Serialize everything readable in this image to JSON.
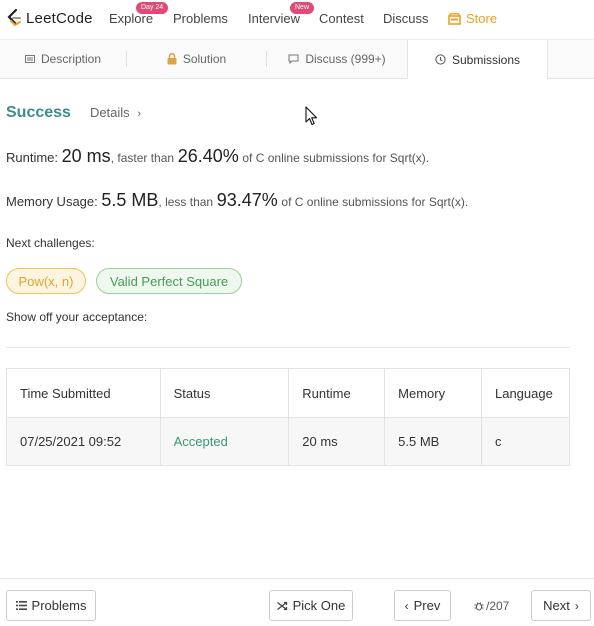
{
  "nav": {
    "brand": "LeetCode",
    "items": [
      {
        "label": "Explore",
        "badge": "Day 24"
      },
      {
        "label": "Problems"
      },
      {
        "label": "Interview",
        "badge": "New"
      },
      {
        "label": "Contest"
      },
      {
        "label": "Discuss"
      },
      {
        "label": "Store"
      }
    ]
  },
  "tabs": [
    {
      "label": "Description",
      "icon": "document-icon"
    },
    {
      "label": "Solution",
      "icon": "lock-icon"
    },
    {
      "label": "Discuss (999+)",
      "icon": "comment-icon"
    },
    {
      "label": "Submissions",
      "icon": "clock-icon",
      "active": true
    }
  ],
  "result": {
    "status": "Success",
    "details_label": "Details",
    "runtime_prefix": "Runtime:",
    "runtime_value": "20 ms",
    "runtime_mid": ", faster than",
    "runtime_pct": "26.40%",
    "runtime_suffix": "of C online submissions for Sqrt(x).",
    "memory_prefix": "Memory Usage:",
    "memory_value": "5.5 MB",
    "memory_mid": ", less than",
    "memory_pct": "93.47%",
    "memory_suffix": "of C online submissions for Sqrt(x).",
    "next_challenges_label": "Next challenges:",
    "challenges": [
      "Pow(x, n)",
      "Valid Perfect Square"
    ],
    "show_off_label": "Show off your acceptance:"
  },
  "table": {
    "headers": [
      "Time Submitted",
      "Status",
      "Runtime",
      "Memory",
      "Language"
    ],
    "rows": [
      [
        "07/25/2021 09:52",
        "Accepted",
        "20 ms",
        "5.5 MB",
        "c"
      ]
    ]
  },
  "bottom": {
    "problems_label": "Problems",
    "pick_one_label": "Pick One",
    "prev_label": "Prev",
    "counter": "/207",
    "next_label": "Next"
  },
  "colors": {
    "success": "#3a8f8a",
    "accepted": "#3a9a72",
    "store": "#f0a020",
    "badge": "#e14a76"
  }
}
